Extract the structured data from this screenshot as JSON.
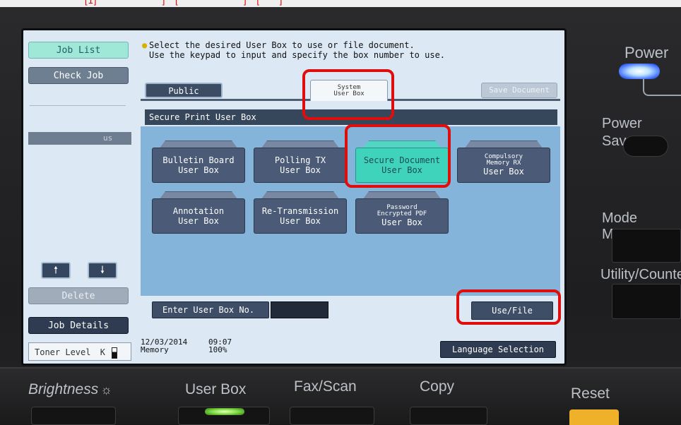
{
  "top_strip": {
    "text": "[1]                    ]   [                    ]   [      ]"
  },
  "left_panel": {
    "job_list": "Job List",
    "check_job": "Check Job",
    "list_fragment": "us",
    "up_arrow": "🠕",
    "down_arrow": "🠗",
    "delete": "Delete",
    "job_details": "Job Details",
    "toner_label": "Toner Level",
    "toner_channel": "K"
  },
  "message": {
    "line1": "Select the desired User Box to use or file document.",
    "line2": "Use the keypad to input and specify the box number to use."
  },
  "tabs": {
    "public": "Public",
    "system_line1": "System",
    "system_line2": "User Box",
    "save_document": "Save Document"
  },
  "section_header": "Secure Print User Box",
  "boxes": [
    {
      "line1": "Bulletin Board",
      "line2": "User Box"
    },
    {
      "line1": "Polling TX",
      "line2": "User Box"
    },
    {
      "line1": "Secure Document",
      "line2": "User Box"
    },
    {
      "line1": "Compulsory",
      "line2": "Memory RX",
      "line3": "User Box"
    },
    {
      "line1": "Annotation",
      "line2": "User Box"
    },
    {
      "line1": "Re-Transmission",
      "line2": "User Box"
    },
    {
      "line1": "Password",
      "line2": "Encrypted PDF",
      "line3": "User Box"
    }
  ],
  "enter_box_label": "Enter User Box No.",
  "use_file": "Use/File",
  "status": {
    "date": "12/03/2014",
    "time": "09:07",
    "memory_label": "Memory",
    "memory_value": "100%"
  },
  "language_selection": "Language Selection",
  "hardware": {
    "power": "Power",
    "power_save": "Power Save",
    "mode_memory": "Mode Memory",
    "utility_counter": "Utility/Counter",
    "brightness": "Brightness",
    "brightness_icon": "sun-icon",
    "user_box": "User Box",
    "fax_scan": "Fax/Scan",
    "copy": "Copy",
    "reset": "Reset"
  },
  "colors": {
    "highlight": "#e00d0d",
    "active_box": "#40d3bb",
    "screen_bg": "#dce8f3"
  }
}
